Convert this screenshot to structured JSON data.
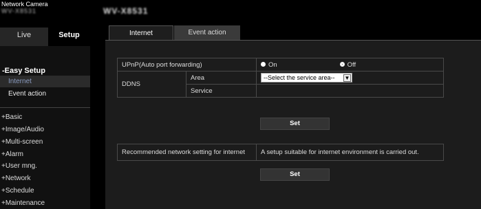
{
  "header": {
    "brand_title": "Network Camera",
    "brand_model": "WV-X8531",
    "page_model": "WV-X8531"
  },
  "sidebar": {
    "tabs": {
      "live": "Live",
      "setup": "Setup"
    },
    "easy_setup": {
      "heading": "-Easy Setup",
      "items": [
        {
          "label": "Internet",
          "selected": true
        },
        {
          "label": "Event action",
          "selected": false
        }
      ]
    },
    "nav": [
      "+Basic",
      "+Image/Audio",
      "+Multi-screen",
      "+Alarm",
      "+User mng.",
      "+Network",
      "+Schedule",
      "+Maintenance"
    ]
  },
  "main": {
    "tabs": [
      {
        "label": "Internet",
        "active": true
      },
      {
        "label": "Event action",
        "active": false
      }
    ],
    "upnp": {
      "label": "UPnP(Auto port forwarding)",
      "options": [
        "On",
        "Off"
      ],
      "selected": "Off"
    },
    "ddns": {
      "label": "DDNS",
      "area_label": "Area",
      "area_value": "--Select the service area--",
      "service_label": "Service",
      "service_value": ""
    },
    "set_label": "Set",
    "recommended": {
      "label": "Recommended network setting for internet",
      "value": "A setup suitable for internet environment is carried out."
    },
    "set_label_2": "Set"
  },
  "colors": {
    "background": "#000000",
    "panel": "#1c1c1c",
    "selected_item_text": "#8a9bbf"
  }
}
